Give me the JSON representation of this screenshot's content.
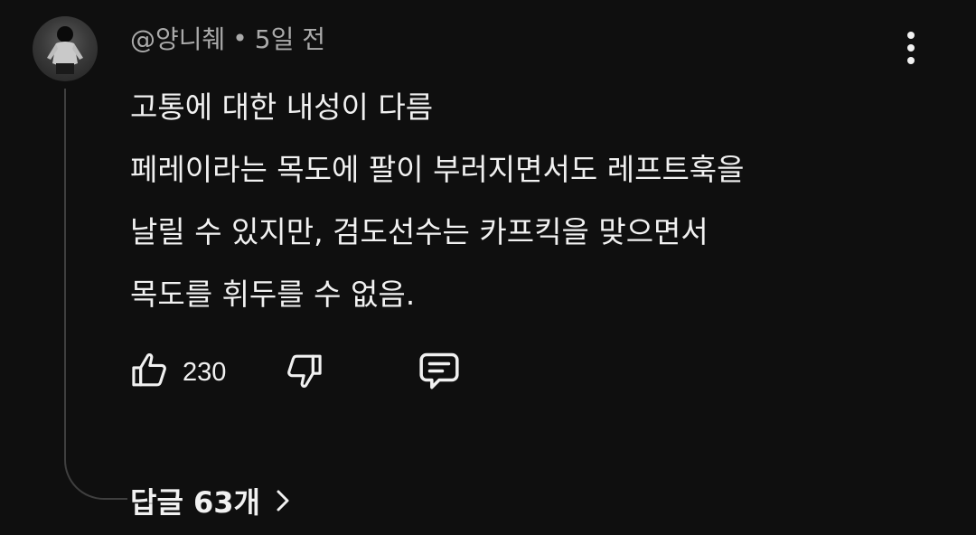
{
  "comment": {
    "author": "@양니췌",
    "separator": "•",
    "time": "5일 전",
    "lines": [
      "고통에 대한 내성이 다름",
      "페레이라는 목도에 팔이 부러지면서도 레프트훅을",
      "날릴 수 있지만, 검도선수는 카프킥을 맞으면서",
      "목도를 휘두를 수 없음."
    ],
    "like_count": "230",
    "replies_label": "답글 63개"
  },
  "icons": {
    "more": "more-vertical-icon",
    "like": "thumbs-up-icon",
    "dislike": "thumbs-down-icon",
    "reply": "comment-icon",
    "chevron": "chevron-right-icon"
  },
  "colors": {
    "background": "#0f0f0f",
    "primary_text": "#f1f1f1",
    "secondary_text": "#aaaaaa",
    "thread_line": "#3f3f3f"
  }
}
